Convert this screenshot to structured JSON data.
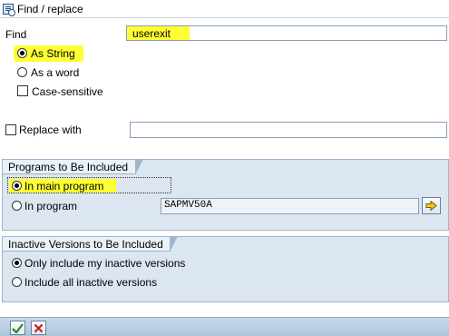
{
  "window": {
    "title": "Find / replace"
  },
  "find": {
    "label": "Find",
    "value": "userexit"
  },
  "mode": {
    "as_string": "As String",
    "as_word": "As a word",
    "case_sensitive": "Case-sensitive"
  },
  "replace": {
    "label": "Replace with",
    "value": ""
  },
  "programs": {
    "title": "Programs to Be Included",
    "in_main": "In main program",
    "in_program": "In program",
    "program_value": "SAPMV50A"
  },
  "inactive": {
    "title": "Inactive Versions to Be Included",
    "only_mine": "Only include my inactive versions",
    "include_all": "Include all inactive versions"
  },
  "colors": {
    "highlight": "#ffff33",
    "panel": "#dbe6f1",
    "panel_border": "#9fb5cc",
    "footer": "#aec5dc"
  },
  "icons": {
    "title": "find-replace-icon",
    "execute_program": "arrow-right-icon",
    "ok": "check-icon",
    "cancel": "x-icon"
  }
}
